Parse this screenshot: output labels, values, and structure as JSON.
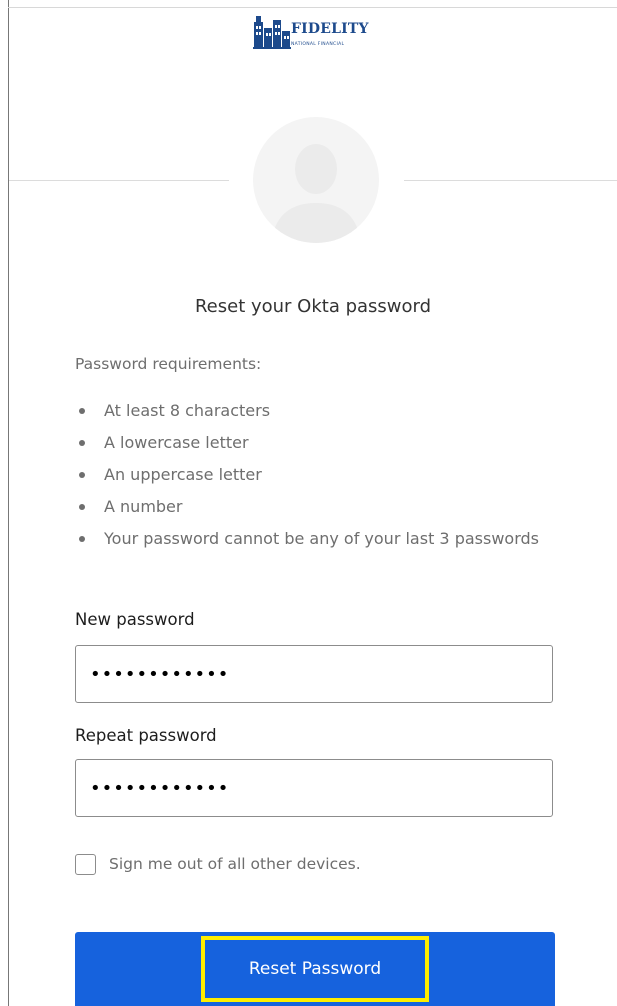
{
  "logo": {
    "name": "FIDELITY",
    "subtitle": "NATIONAL FINANCIAL",
    "color": "#1d4a8c"
  },
  "form": {
    "title": "Reset your Okta password",
    "requirements_title": "Password requirements:",
    "requirements": [
      "At least 8 characters",
      "A lowercase letter",
      "An uppercase letter",
      "A number",
      "Your password cannot be any of your last 3 passwords"
    ],
    "new_password_label": "New password",
    "new_password_value": "••••••••••••",
    "repeat_password_label": "Repeat password",
    "repeat_password_value": "••••••••••••",
    "sign_out_label": "Sign me out of all other devices.",
    "sign_out_checked": false,
    "submit_label": "Reset Password"
  },
  "colors": {
    "primary_button": "#1662dd",
    "highlight": "#ffee00",
    "text_muted": "#6e6e6e"
  },
  "icons": {
    "avatar": "user-silhouette-icon",
    "logo": "building-logo-icon"
  }
}
